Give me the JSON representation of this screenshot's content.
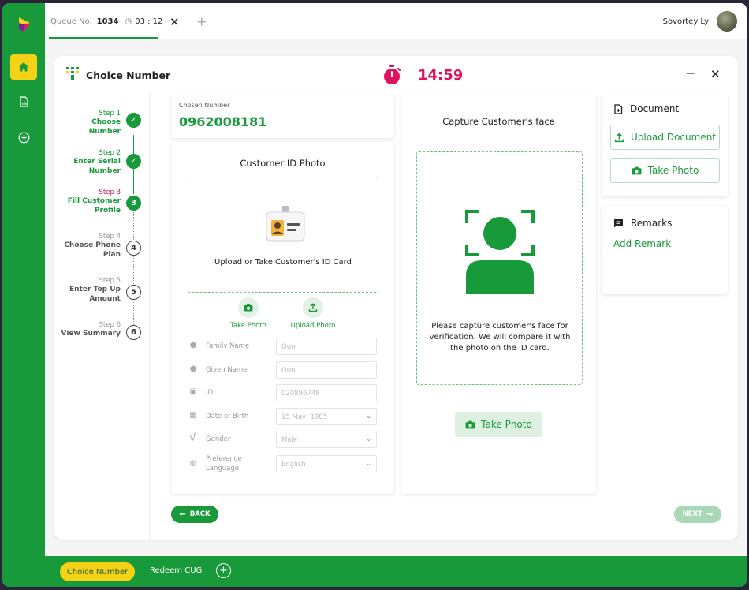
{
  "queue": {
    "label": "Queue No.",
    "number": "1034",
    "time": "03 : 12"
  },
  "user": {
    "name": "Sovortey Ly"
  },
  "panel": {
    "title": "Choice Number",
    "timer": "14:59"
  },
  "steps": [
    {
      "num": "Step 1",
      "label": "Choose Number",
      "state": "done"
    },
    {
      "num": "Step 2",
      "label": "Enter Serial Number",
      "state": "done"
    },
    {
      "num": "Step 3",
      "label": "Fill Customer Profile",
      "state": "current",
      "badge": "3"
    },
    {
      "num": "Step 4",
      "label": "Choose Phone Plan",
      "state": "todo",
      "badge": "4"
    },
    {
      "num": "Step 5",
      "label": "Enter Top Up Amount",
      "state": "todo",
      "badge": "5"
    },
    {
      "num": "Step 6",
      "label": "View Summary",
      "state": "todo",
      "badge": "6"
    }
  ],
  "chosen": {
    "label": "Chosen Number",
    "value": "0962008181"
  },
  "id_card": {
    "title": "Customer ID Photo",
    "hint": "Upload or Take Customer's ID Card",
    "take_photo": "Take Photo",
    "upload_photo": "Upload Photo"
  },
  "form": {
    "family_name": {
      "label": "Family Name",
      "placeholder": "Oun"
    },
    "given_name": {
      "label": "Given Name",
      "placeholder": "Oun"
    },
    "id": {
      "label": "ID",
      "placeholder": "020896748"
    },
    "dob": {
      "label": "Date of Birth",
      "value": "15 May, 1985"
    },
    "gender": {
      "label": "Gender",
      "value": "Male"
    },
    "language": {
      "label": "Preference Language",
      "value": "English"
    }
  },
  "face": {
    "title": "Capture Customer's face",
    "hint": "Please capture customer's face for verification. We will compare it with the photo on the ID card.",
    "take_photo": "Take Photo"
  },
  "document": {
    "title": "Document",
    "upload": "Upload Document",
    "take_photo": "Take Photo"
  },
  "remarks": {
    "title": "Remarks",
    "add": "Add Remark"
  },
  "nav": {
    "back": "BACK",
    "next": "NEXT"
  },
  "bottom_tabs": {
    "active": "Choice Number",
    "other": "Redeem CUG",
    "add": "+"
  },
  "colors": {
    "primary": "#189a3a",
    "accent": "#f5d215",
    "timer": "#e0115f"
  }
}
